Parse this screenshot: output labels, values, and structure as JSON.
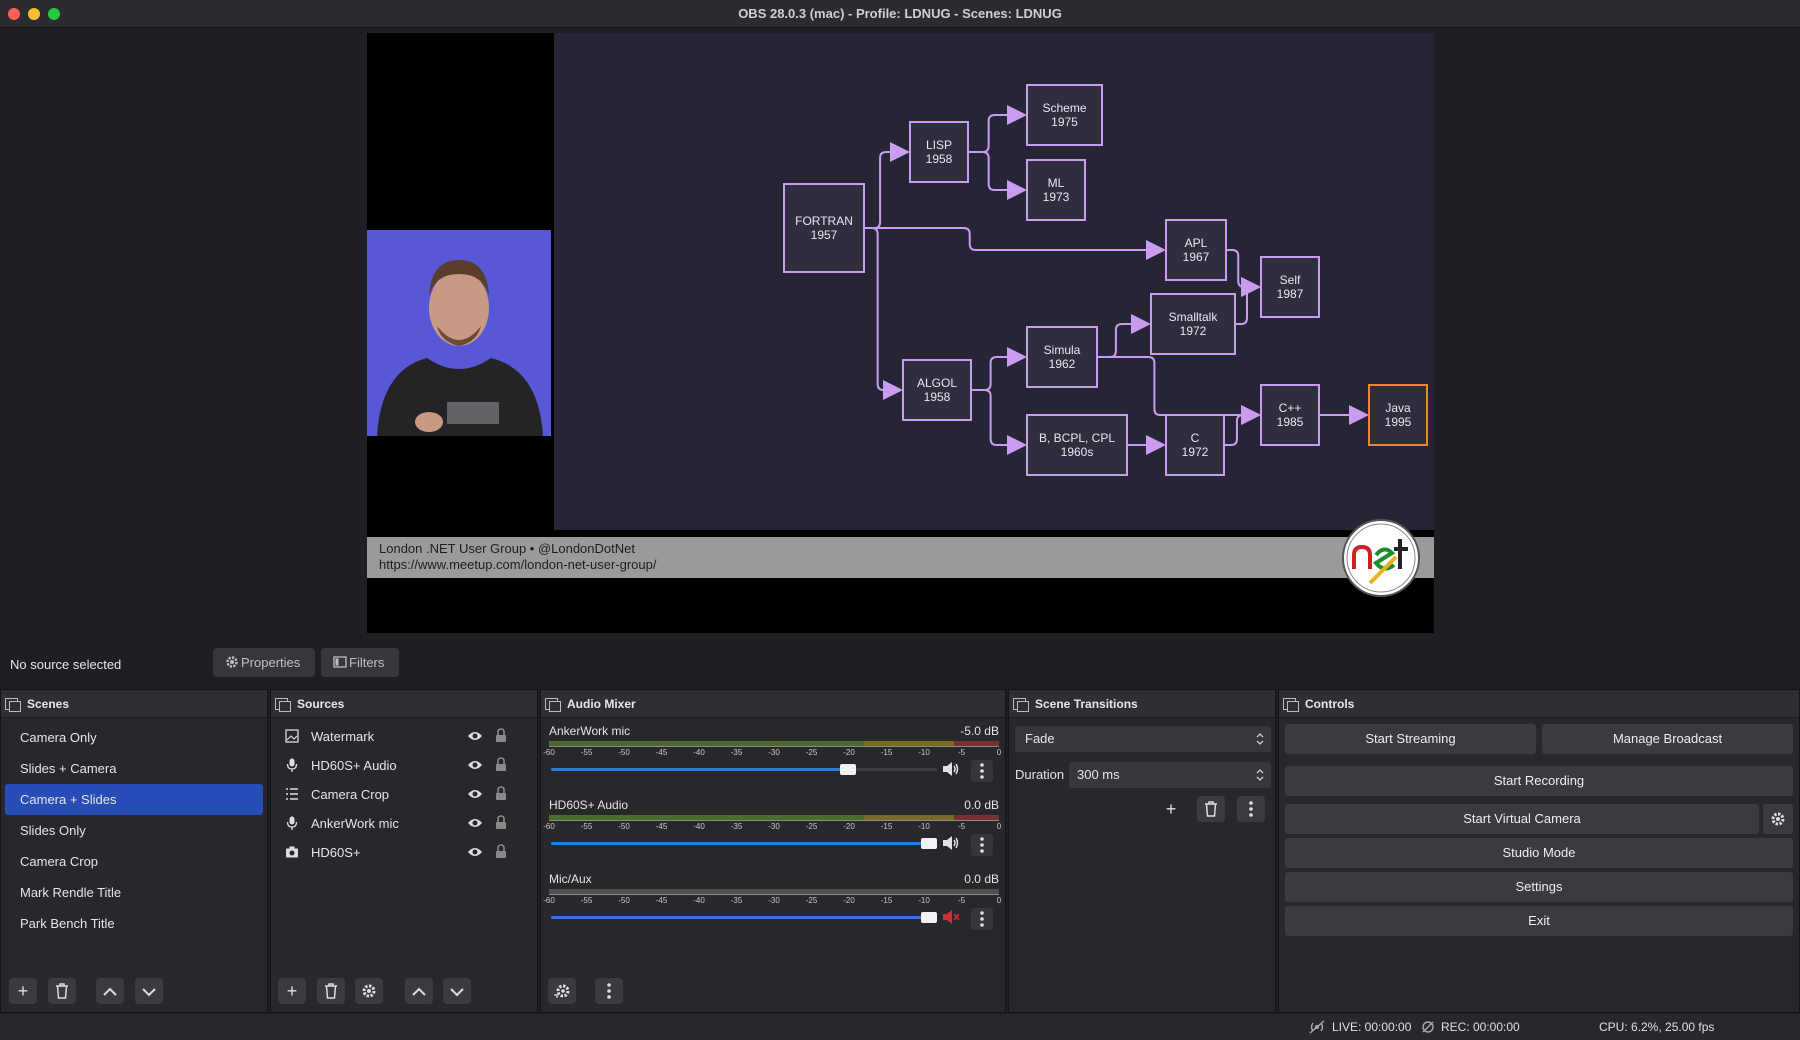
{
  "window": {
    "title": "OBS 28.0.3 (mac) - Profile: LDNUG - Scenes: LDNUG"
  },
  "preview": {
    "lower_third": {
      "line1": "London .NET User Group • @LondonDotNet",
      "line2": "https://www.meetup.com/london-net-user-group/"
    },
    "diagram_nodes": [
      {
        "name": "FORTRAN",
        "year": "1957"
      },
      {
        "name": "LISP",
        "year": "1958"
      },
      {
        "name": "Scheme",
        "year": "1975"
      },
      {
        "name": "ML",
        "year": "1973"
      },
      {
        "name": "APL",
        "year": "1967"
      },
      {
        "name": "Self",
        "year": "1987"
      },
      {
        "name": "Smalltalk",
        "year": "1972"
      },
      {
        "name": "Simula",
        "year": "1962"
      },
      {
        "name": "ALGOL",
        "year": "1958"
      },
      {
        "name": "C++",
        "year": "1985"
      },
      {
        "name": "Java",
        "year": "1995"
      },
      {
        "name": "B, BCPL, CPL",
        "year": "1960s"
      },
      {
        "name": "C",
        "year": "1972"
      }
    ],
    "diagram_edges": [
      [
        "FORTRAN",
        "LISP"
      ],
      [
        "FORTRAN",
        "APL"
      ],
      [
        "FORTRAN",
        "ALGOL"
      ],
      [
        "LISP",
        "Scheme"
      ],
      [
        "LISP",
        "ML"
      ],
      [
        "APL",
        "Self"
      ],
      [
        "Smalltalk",
        "Self"
      ],
      [
        "ALGOL",
        "Simula"
      ],
      [
        "ALGOL",
        "B, BCPL, CPL"
      ],
      [
        "Simula",
        "Smalltalk"
      ],
      [
        "Simula",
        "C++"
      ],
      [
        "B, BCPL, CPL",
        "C"
      ],
      [
        "C",
        "C++"
      ],
      [
        "C++",
        "Java"
      ]
    ]
  },
  "status_row": {
    "no_source": "No source selected",
    "properties": "Properties",
    "filters": "Filters"
  },
  "scenes": {
    "title": "Scenes",
    "items": [
      "Camera Only",
      "Slides + Camera",
      "Camera + Slides",
      "Slides Only",
      "Camera Crop",
      "Mark Rendle Title",
      "Park Bench Title"
    ],
    "selected": "Camera + Slides"
  },
  "sources": {
    "title": "Sources",
    "items": [
      {
        "name": "Watermark",
        "icon": "image-icon"
      },
      {
        "name": "HD60S+ Audio",
        "icon": "microphone-icon"
      },
      {
        "name": "Camera Crop",
        "icon": "list-icon"
      },
      {
        "name": "AnkerWork mic",
        "icon": "microphone-icon"
      },
      {
        "name": "HD60S+",
        "icon": "camera-icon"
      }
    ]
  },
  "mixer": {
    "title": "Audio Mixer",
    "ticks": [
      "-60",
      "-55",
      "-50",
      "-45",
      "-40",
      "-35",
      "-30",
      "-25",
      "-20",
      "-15",
      "-10",
      "-5",
      "0"
    ],
    "channels": [
      {
        "name": "AnkerWork mic",
        "db": "-5.0 dB",
        "volume": 0.77,
        "muted": false
      },
      {
        "name": "HD60S+ Audio",
        "db": "0.0 dB",
        "volume": 0.98,
        "muted": false
      },
      {
        "name": "Mic/Aux",
        "db": "0.0 dB",
        "volume": 0.98,
        "muted": true
      }
    ]
  },
  "transitions": {
    "title": "Scene Transitions",
    "selected": "Fade",
    "duration_label": "Duration",
    "duration_value": "300 ms"
  },
  "controls": {
    "title": "Controls",
    "start_streaming": "Start Streaming",
    "manage_broadcast": "Manage Broadcast",
    "start_recording": "Start Recording",
    "start_virtual_camera": "Start Virtual Camera",
    "studio_mode": "Studio Mode",
    "settings": "Settings",
    "exit": "Exit"
  },
  "statusbar": {
    "live": "LIVE: 00:00:00",
    "rec": "REC: 00:00:00",
    "cpu": "CPU: 6.2%, 25.00 fps"
  },
  "colors": {
    "accent": "#284cb8",
    "diagram_stroke": "#c99cf0",
    "highlight_node": "#e88a2a",
    "slider": "#2f7ad8"
  }
}
